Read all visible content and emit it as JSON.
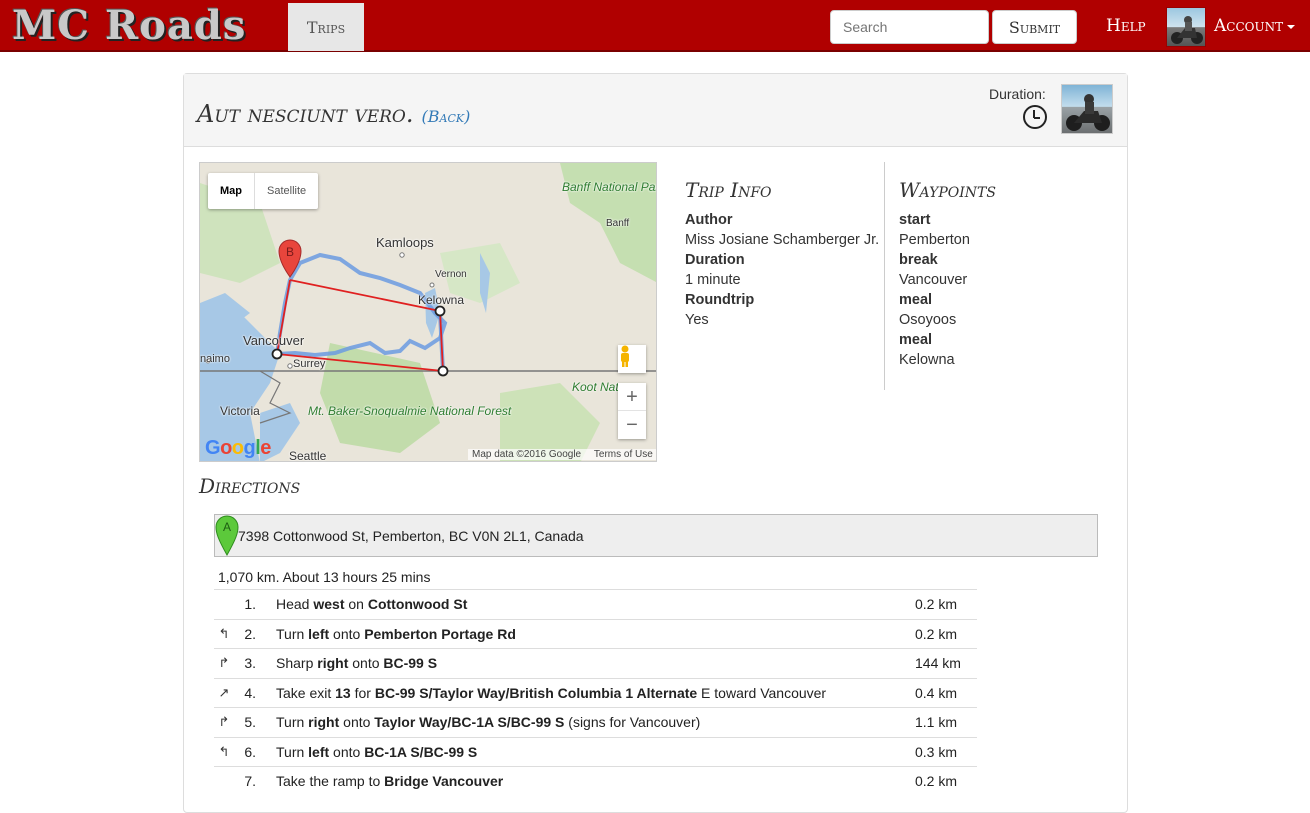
{
  "navbar": {
    "brand": "MC Roads",
    "trips_label": "Trips",
    "search_placeholder": "Search",
    "submit_label": "Submit",
    "help_label": "Help",
    "account_label": "Account"
  },
  "trip": {
    "title": "Aut nesciunt vero.",
    "back_label": "(Back)",
    "duration_label": "Duration:"
  },
  "map": {
    "type_map": "Map",
    "type_satellite": "Satellite",
    "labels": {
      "kamloops": "Kamloops",
      "vernon": "Vernon",
      "kelowna": "Kelowna",
      "vancouver": "Vancouver",
      "surrey": "Surrey",
      "nanaimo": "naimo",
      "victoria": "Victoria",
      "seattle": "Seattle",
      "banff_park": "Banff National Park",
      "banff": "Banff",
      "baker": "Mt. Baker-Snoqualmie National Forest",
      "kootenay": "Koot National es"
    },
    "marker_b": "B",
    "google_logo": "Google",
    "attribution": "Map data ©2016 Google",
    "terms": "Terms of Use"
  },
  "trip_info": {
    "heading": "Trip Info",
    "author_label": "Author",
    "author_value": "Miss Josiane Schamberger Jr.",
    "duration_label": "Duration",
    "duration_value": "1 minute",
    "roundtrip_label": "Roundtrip",
    "roundtrip_value": "Yes"
  },
  "waypoints": {
    "heading": "Waypoints",
    "items": [
      {
        "type": "start",
        "place": "Pemberton"
      },
      {
        "type": "break",
        "place": "Vancouver"
      },
      {
        "type": "meal",
        "place": "Osoyoos"
      },
      {
        "type": "meal",
        "place": "Kelowna"
      }
    ]
  },
  "directions": {
    "heading": "Directions",
    "start_marker": "A",
    "start_address": "7398 Cottonwood St, Pemberton, BC V0N 2L1, Canada",
    "summary": "1,070 km. About 13 hours 25 mins",
    "steps": [
      {
        "turn": "",
        "num": "1.",
        "parts": [
          "Head ",
          "west",
          " on ",
          "Cottonwood St",
          ""
        ],
        "dist": "0.2 km"
      },
      {
        "turn": "↰",
        "num": "2.",
        "parts": [
          "Turn ",
          "left",
          " onto ",
          "Pemberton Portage Rd",
          ""
        ],
        "dist": "0.2 km"
      },
      {
        "turn": "↱",
        "num": "3.",
        "parts": [
          "Sharp ",
          "right",
          " onto ",
          "BC-99 S",
          ""
        ],
        "dist": "144 km"
      },
      {
        "turn": "↗",
        "num": "4.",
        "parts": [
          "Take exit ",
          "13",
          " for ",
          "BC-99 S/Taylor Way/British Columbia 1 Alternate",
          " E toward Vancouver"
        ],
        "dist": "0.4 km"
      },
      {
        "turn": "↱",
        "num": "5.",
        "parts": [
          "Turn ",
          "right",
          " onto ",
          "Taylor Way/BC-1A S/BC-99 S",
          " (signs for Vancouver)"
        ],
        "dist": "1.1 km"
      },
      {
        "turn": "↰",
        "num": "6.",
        "parts": [
          "Turn ",
          "left",
          " onto ",
          "BC-1A S/BC-99 S",
          ""
        ],
        "dist": "0.3 km"
      },
      {
        "turn": "",
        "num": "7.",
        "parts": [
          "Take the ramp to ",
          "Bridge Vancouver",
          "",
          "",
          ""
        ],
        "dist": "0.2 km"
      }
    ]
  }
}
